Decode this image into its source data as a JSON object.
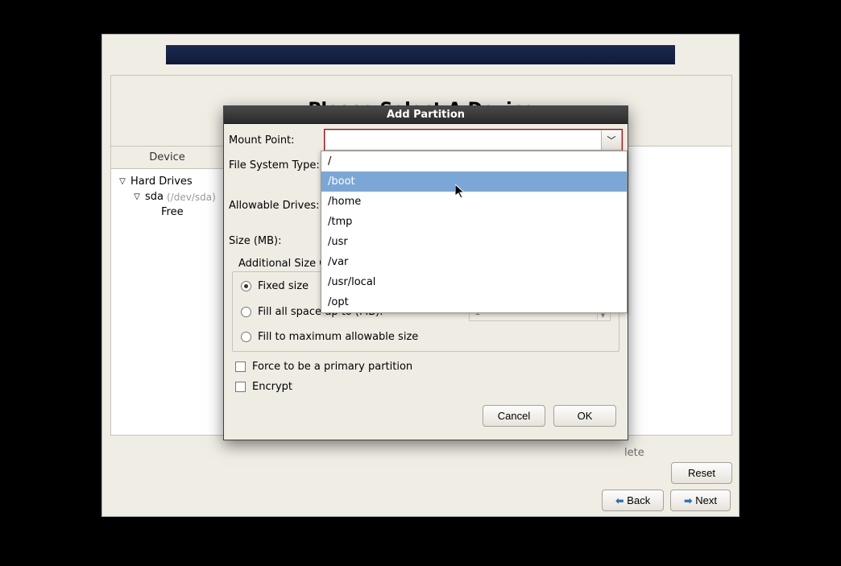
{
  "page_title": "Please Select A Device",
  "device_tree": {
    "header": "Device",
    "hard_drives": "Hard Drives",
    "sda": "sda",
    "sda_path": "(/dev/sda)",
    "free": "Free"
  },
  "bottom": {
    "delete": "lete",
    "reset": "Reset"
  },
  "nav": {
    "back": "Back",
    "next": "Next"
  },
  "modal": {
    "title": "Add Partition",
    "mount_point_label": "Mount Point:",
    "fs_type_label": "File System Type:",
    "allowable_label": "Allowable Drives:",
    "size_label": "Size (MB):",
    "addl_size_heading": "Additional Size Op",
    "radio": {
      "fixed": "Fixed size",
      "fill_upto": "Fill all space up to (MB):",
      "fill_max": "Fill to maximum allowable size"
    },
    "spinner_value": "1",
    "force_primary": "Force to be a primary partition",
    "encrypt": "Encrypt",
    "cancel": "Cancel",
    "ok": "OK"
  },
  "dropdown": {
    "items": [
      "/",
      "/boot",
      "/home",
      "/tmp",
      "/usr",
      "/var",
      "/usr/local",
      "/opt"
    ],
    "highlighted_index": 1
  }
}
